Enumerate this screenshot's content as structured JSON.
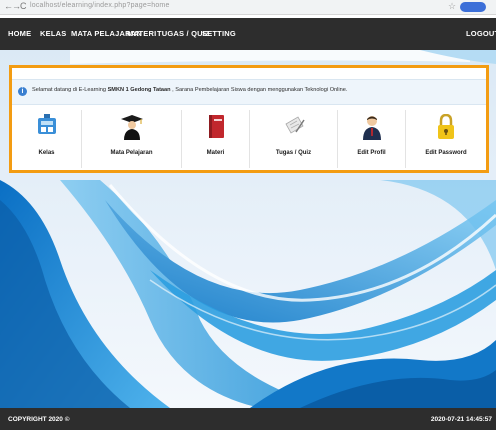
{
  "browser": {
    "back": "←",
    "forward": "→",
    "reload": "C",
    "url": "localhost/elearning/index.php?page=home"
  },
  "nav": {
    "items": [
      {
        "label": "HOME"
      },
      {
        "label": "KELAS"
      },
      {
        "label": "MATA PELAJARAN"
      },
      {
        "label": "MATERI"
      },
      {
        "label": "TUGAS / QUIZ"
      },
      {
        "label": "SETTING"
      }
    ],
    "logout": "LOGOUT"
  },
  "welcome": {
    "prefix": "Selamat datang di E-Learning ",
    "school": "SMKN 1 Gedong Tataan",
    "suffix": " , Sarana Pembelajaran Siswa dengan menggunakan Teknologi Online."
  },
  "menu": [
    {
      "label": "Kelas",
      "icon": "class-icon"
    },
    {
      "label": "Mata Pelajaran",
      "icon": "graduate-icon"
    },
    {
      "label": "Materi",
      "icon": "book-icon"
    },
    {
      "label": "Tugas / Quiz",
      "icon": "quiz-icon"
    },
    {
      "label": "Edit Profil",
      "icon": "profile-icon"
    },
    {
      "label": "Edit Password",
      "icon": "lock-icon"
    }
  ],
  "footer": {
    "copyright": "COPYRIGHT 2020 ©",
    "timestamp": "2020-07-21 14:45:57"
  },
  "colors": {
    "nav_bg": "#2d2d2d",
    "panel_border": "#f39c12",
    "wave_blue": "#1f8fd6"
  }
}
